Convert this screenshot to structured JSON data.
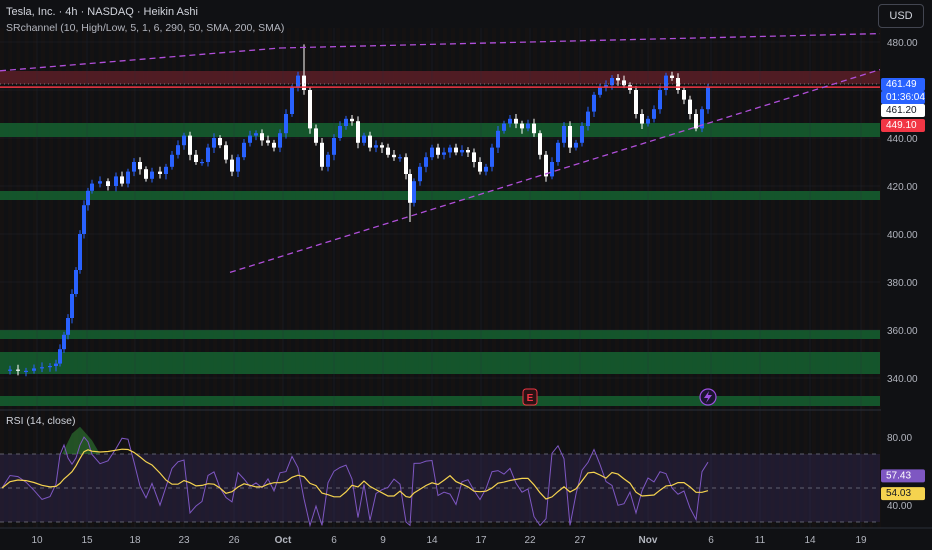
{
  "header": {
    "symbol_line": "Tesla, Inc. · 4h · NASDAQ · Heikin Ashi",
    "indicator_line": "SRchannel (10, High/Low, 5, 1, 6, 290, 50, SMA, 200, SMA)"
  },
  "currency_button": "USD",
  "rsi": {
    "label": "RSI (14, close)",
    "ticks": [
      "80.00",
      "40.00"
    ],
    "value_rsi": "57.43",
    "value_ma": "54.03"
  },
  "price_axis": {
    "ticks": [
      "480.00",
      "460.00",
      "440.00",
      "420.00",
      "400.00",
      "380.00",
      "360.00",
      "340.00"
    ],
    "tag_last": "461.49",
    "tag_countdown": "01:36:04",
    "tag_line": "461.20",
    "tag_red": "449.10"
  },
  "time_axis": [
    "10",
    "15",
    "18",
    "23",
    "26",
    "Oct",
    "6",
    "9",
    "14",
    "17",
    "22",
    "27",
    "Nov",
    "6",
    "11",
    "14",
    "19"
  ],
  "markers": {
    "earnings": "E"
  },
  "colors": {
    "background": "#101114",
    "bull_candle": "#2962ff",
    "bear_candle": "#ffffff",
    "support_zone": "#1e7a3e",
    "resistance_zone": "#7a2530",
    "red_line": "#f23645",
    "trendline": "#b04fd9",
    "rsi_line": "#7e57c2",
    "rsi_ma": "#f5d34f"
  }
}
